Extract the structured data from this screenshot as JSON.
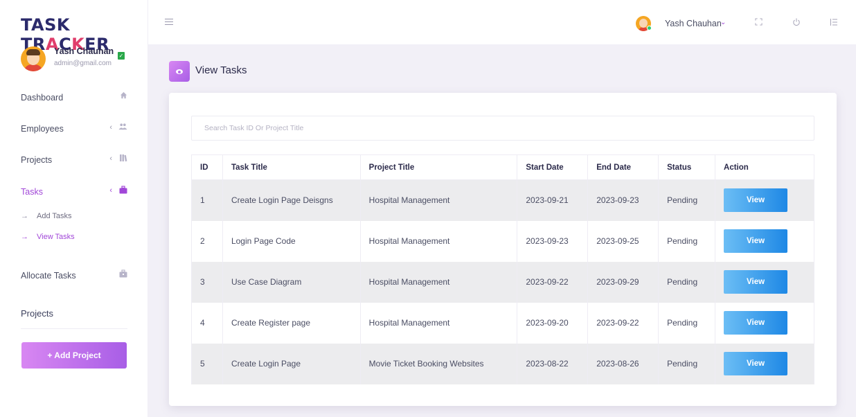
{
  "app": {
    "logo_parts": [
      "TASK TR",
      "A",
      "C",
      "K",
      "ER"
    ]
  },
  "profile": {
    "name": "Yash Chauhan",
    "email": "admin@gmail.com"
  },
  "sidebar": {
    "items": [
      {
        "label": "Dashboard",
        "icon": "home-icon"
      },
      {
        "label": "Employees",
        "icon": "users-icon"
      },
      {
        "label": "Projects",
        "icon": "books-icon"
      },
      {
        "label": "Tasks",
        "icon": "briefcase-icon",
        "active": true
      },
      {
        "label": "Allocate Tasks",
        "icon": "briefcase-outline-icon"
      }
    ],
    "sub_items": [
      {
        "label": "Add Tasks"
      },
      {
        "label": "View Tasks",
        "active": true
      }
    ],
    "section_title": "Projects",
    "add_project_label": "+ Add Project",
    "chevron": "‹",
    "arrow": "→"
  },
  "topbar": {
    "user_name": "Yash Chauhan",
    "chevron": "⌄"
  },
  "page": {
    "title": "View Tasks"
  },
  "search": {
    "placeholder": "Search Task ID Or Project Title",
    "value": ""
  },
  "table": {
    "headers": {
      "id": "ID",
      "task_title": "Task Title",
      "project_title": "Project Title",
      "start_date": "Start Date",
      "end_date": "End Date",
      "status": "Status",
      "action": "Action"
    },
    "action_label": "View",
    "rows": [
      {
        "id": "1",
        "task_title": "Create Login Page Deisgns",
        "project_title": "Hospital Management",
        "start_date": "2023-09-21",
        "end_date": "2023-09-23",
        "status": "Pending"
      },
      {
        "id": "2",
        "task_title": "Login Page Code",
        "project_title": "Hospital Management",
        "start_date": "2023-09-23",
        "end_date": "2023-09-25",
        "status": "Pending"
      },
      {
        "id": "3",
        "task_title": "Use Case Diagram",
        "project_title": "Hospital Management",
        "start_date": "2023-09-22",
        "end_date": "2023-09-29",
        "status": "Pending"
      },
      {
        "id": "4",
        "task_title": "Create Register page",
        "project_title": "Hospital Management",
        "start_date": "2023-09-20",
        "end_date": "2023-09-22",
        "status": "Pending"
      },
      {
        "id": "5",
        "task_title": "Create Login Page",
        "project_title": "Movie Ticket Booking Websites",
        "start_date": "2023-08-22",
        "end_date": "2023-08-26",
        "status": "Pending"
      }
    ]
  },
  "colors": {
    "brand_navy": "#2b2a6b",
    "brand_accent": "#e03e6b",
    "active_purple": "#a147d8",
    "button_blue": "#1e88e5"
  }
}
